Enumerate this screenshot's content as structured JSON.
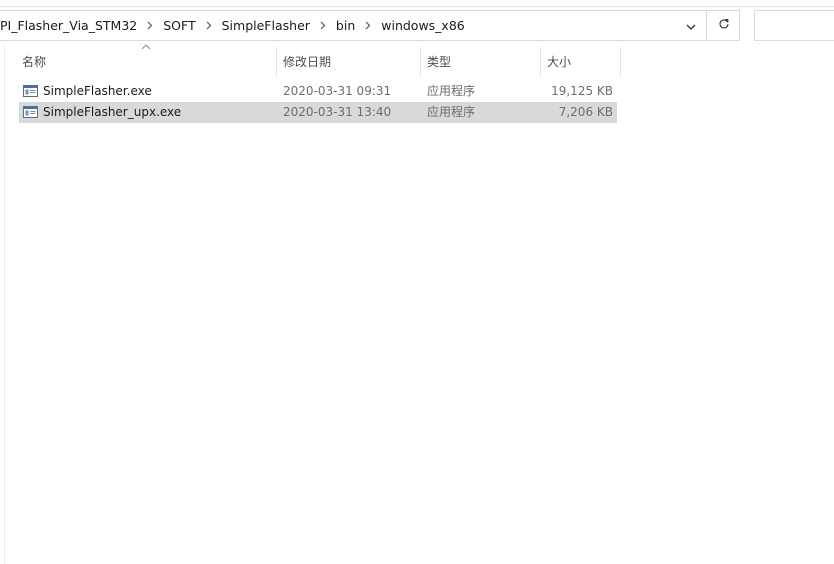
{
  "address_bar": {
    "breadcrumbs": [
      "PI_Flasher_Via_STM32",
      "SOFT",
      "SimpleFlasher",
      "bin",
      "windows_x86"
    ]
  },
  "columns": {
    "name": "名称",
    "date": "修改日期",
    "type": "类型",
    "size": "大小"
  },
  "files": [
    {
      "name": "SimpleFlasher.exe",
      "date": "2020-03-31 09:31",
      "type": "应用程序",
      "size": "19,125 KB",
      "selected": false
    },
    {
      "name": "SimpleFlasher_upx.exe",
      "date": "2020-03-31 13:40",
      "type": "应用程序",
      "size": "7,206 KB",
      "selected": true
    }
  ],
  "icons": {
    "dropdown": "chevron-down-icon",
    "refresh": "refresh-icon",
    "file": "exe-file-icon",
    "sort": "sort-ascending-icon"
  },
  "colors": {
    "selection": "#d9d9d9",
    "border": "#d9d9d9",
    "secondary_text": "#6d6d6d"
  }
}
